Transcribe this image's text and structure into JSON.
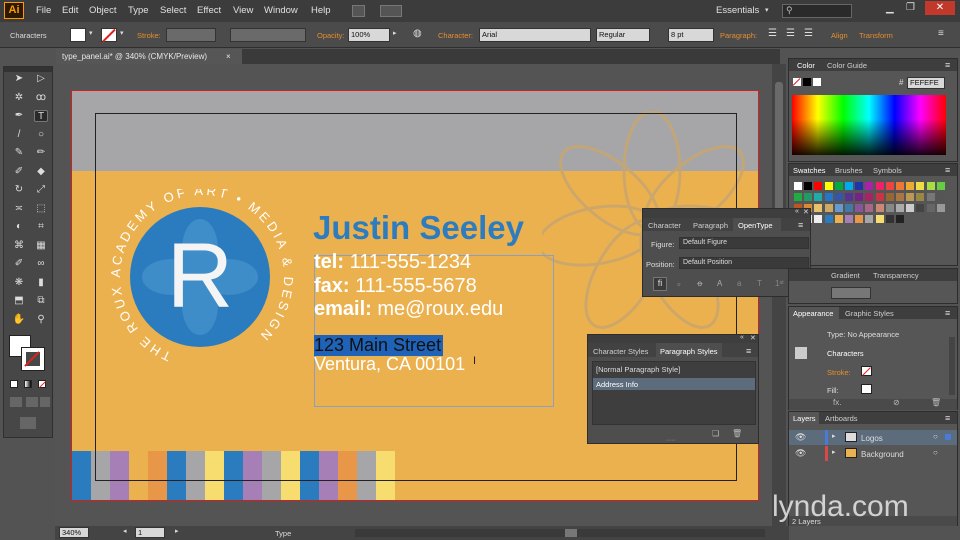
{
  "app": {
    "logo": "Ai",
    "search_placeholder": ""
  },
  "menu": [
    "File",
    "Edit",
    "Object",
    "Type",
    "Select",
    "Effect",
    "View",
    "Window",
    "Help"
  ],
  "workspace": "Essentials",
  "control": {
    "selection_label": "Characters",
    "stroke_label": "Stroke:",
    "opacity_label": "Opacity:",
    "opacity_value": "100%",
    "character_label": "Character:",
    "font_value": "Arial",
    "style_value": "Regular",
    "size_value": "8 pt",
    "paragraph_label": "Paragraph:",
    "align_label": "Align",
    "transform_label": "Transform"
  },
  "doc_tab": {
    "title": "type_panel.ai* @ 340% (CMYK/Preview)",
    "close": "×"
  },
  "card": {
    "circle_text": "THE ROUX ACADEMY OF ART • MEDIA & DESIGN",
    "monogram": "R",
    "name": "Justin Seeley",
    "tel_label": "tel:",
    "tel": "111-555-1234",
    "fax_label": "fax:",
    "fax": "111-555-5678",
    "email_label": "email:",
    "email": "me@roux.edu",
    "address1": "123 Main Street",
    "address2": "Ventura, CA 00101"
  },
  "color_panel": {
    "tabs": [
      "Color",
      "Color Guide"
    ],
    "hex": "FEFEFE"
  },
  "swatches_panel": {
    "tabs": [
      "Swatches",
      "Brushes",
      "Symbols"
    ]
  },
  "opentype_panel": {
    "tabs": [
      "Character",
      "Paragraph",
      "OpenType"
    ],
    "figure_label": "Figure:",
    "figure_value": "Default Figure",
    "position_label": "Position:",
    "position_value": "Default Position"
  },
  "gradient_panel": {
    "tabs": [
      "Gradient",
      "Transparency"
    ]
  },
  "appearance_panel": {
    "tabs": [
      "Appearance",
      "Graphic Styles"
    ],
    "type_line": "Type: No Appearance",
    "characters": "Characters",
    "stroke_label": "Stroke:",
    "fill_label": "Fill:"
  },
  "styles_panel": {
    "tabs": [
      "Character Styles",
      "Paragraph Styles"
    ],
    "items": [
      "[Normal Paragraph Style]",
      "Address Info"
    ]
  },
  "layers_panel": {
    "tabs": [
      "Layers",
      "Artboards"
    ],
    "layers": [
      "Logos",
      "Background"
    ],
    "count": "2 Layers"
  },
  "status": {
    "zoom": "340%",
    "artboard": "1",
    "tool": "Type"
  },
  "watermark": "lynda.com",
  "colors": {
    "artboard_yellow": "#ecb14f",
    "artboard_gray": "#a6a6a8",
    "brand_blue": "#2b7cbf",
    "name_blue": "#2d7cc0",
    "selection": "#1f63b8"
  },
  "stripe_colors": [
    "#2b7cbf",
    "#a6a6a8",
    "#a57fb5",
    "#ecb14f",
    "#e89648",
    "#2b7cbf",
    "#a6a6a8",
    "#f7dc6f",
    "#2b7cbf",
    "#a57fb5",
    "#a6a6a8",
    "#f7dc6f",
    "#2b7cbf",
    "#a57fb5",
    "#e89648",
    "#a6a6a8",
    "#f7dc6f"
  ]
}
